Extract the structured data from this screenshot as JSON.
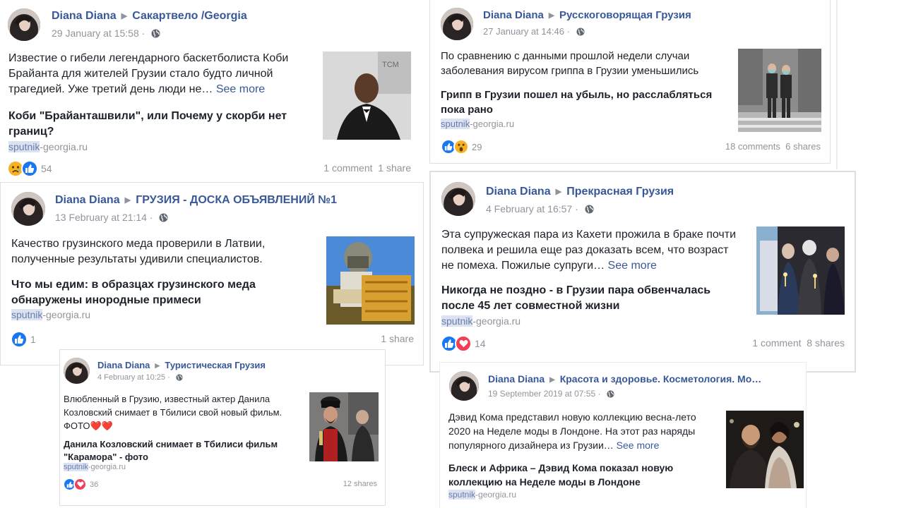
{
  "posts": [
    {
      "author": "Diana Diana",
      "group": "Сакартвело /Georgia",
      "time": "29 January at 15:58",
      "text": "Известие о гибели легендарного баскетболиста Коби Брайанта для жителей Грузии стало будто личной трагедией. Уже третий день люди не…",
      "see_more": "See more",
      "headline": "Коби \"Брайанташвили\", или Почему у скорби нет границ?",
      "source_hl": "sputnik",
      "source_rest": "-georgia.ru",
      "reactions": [
        "sad",
        "like"
      ],
      "reaction_count": "54",
      "comments": "1 comment",
      "shares": "1 share"
    },
    {
      "author": "Diana Diana",
      "group": "Русскоговорящая Грузия",
      "time": "27 January at 14:46",
      "text": "По сравнению с данными прошлой недели случаи заболевания вирусом гриппа в Грузии уменьшились",
      "see_more": "",
      "headline": "Грипп в Грузии пошел на убыль, но расслабляться пока рано",
      "source_hl": "sputnik",
      "source_rest": "-georgia.ru",
      "reactions": [
        "like",
        "wow"
      ],
      "reaction_count": "29",
      "comments": "18 comments",
      "shares": "6 shares"
    },
    {
      "author": "Diana Diana",
      "group": "ГРУЗИЯ - ДОСКА ОБЪЯВЛЕНИЙ №1",
      "time": "13 February at 21:14",
      "text": "Качество грузинского меда проверили в Латвии, полученные результаты удивили специалистов.",
      "see_more": "",
      "headline": "Что мы едим: в образцах грузинского меда обнаружены инородные примеси",
      "source_hl": "sputnik",
      "source_rest": "-georgia.ru",
      "reactions": [
        "like"
      ],
      "reaction_count": "1",
      "comments": "",
      "shares": "1 share"
    },
    {
      "author": "Diana Diana",
      "group": "Прекрасная Грузия",
      "time": "4 February at 16:57",
      "text": "Эта супружеская пара из Кахети прожила в браке почти полвека и решила еще раз доказать всем, что возраст не помеха. Пожилые супруги…",
      "see_more": "See more",
      "headline": "Никогда не поздно - в Грузии пара обвенчалась после 45 лет совместной жизни",
      "source_hl": "sputnik",
      "source_rest": "-georgia.ru",
      "reactions": [
        "like",
        "love"
      ],
      "reaction_count": "14",
      "comments": "1 comment",
      "shares": "8 shares"
    },
    {
      "author": "Diana Diana",
      "group": "Туристическая Грузия",
      "time": "4 February at 10:25",
      "text": "Влюбленный в Грузию, известный актер Данила Козловский снимает в Тбилиси свой новый фильм. ФОТО❤️❤️",
      "see_more": "",
      "headline": "Данила Козловский снимает в Тбилиси фильм \"Карамора\" - фото",
      "source_hl": "sputnik",
      "source_rest": "-georgia.ru",
      "reactions": [
        "like",
        "love"
      ],
      "reaction_count": "36",
      "comments": "",
      "shares": "12 shares"
    },
    {
      "author": "Diana Diana",
      "group": "Красота и здоровье. Косметология. Мо…",
      "time": "19 September 2019 at 07:55",
      "text": "Дэвид Кома представил новую коллекцию весна-лето 2020 на Неделе моды в Лондоне. На этот раз наряды популярного дизайнера из Грузии…",
      "see_more": "See more",
      "headline": "Блеск и Африка – Дэвид Кома показал новую коллекцию на Неделе моды в Лондоне",
      "source_hl": "sputnik",
      "source_rest": "-georgia.ru"
    }
  ],
  "colors": {
    "link_blue": "#385898",
    "meta_gray": "#90949c",
    "like_blue": "#1877f2",
    "love_red": "#f33e58",
    "emoji_yellow": "#f7b125"
  },
  "icons": {
    "like": "like-reaction-icon",
    "love": "love-reaction-icon",
    "sad": "sad-reaction-icon",
    "wow": "wow-reaction-icon",
    "globe": "globe-icon",
    "arrow": "triangle-right-icon"
  }
}
